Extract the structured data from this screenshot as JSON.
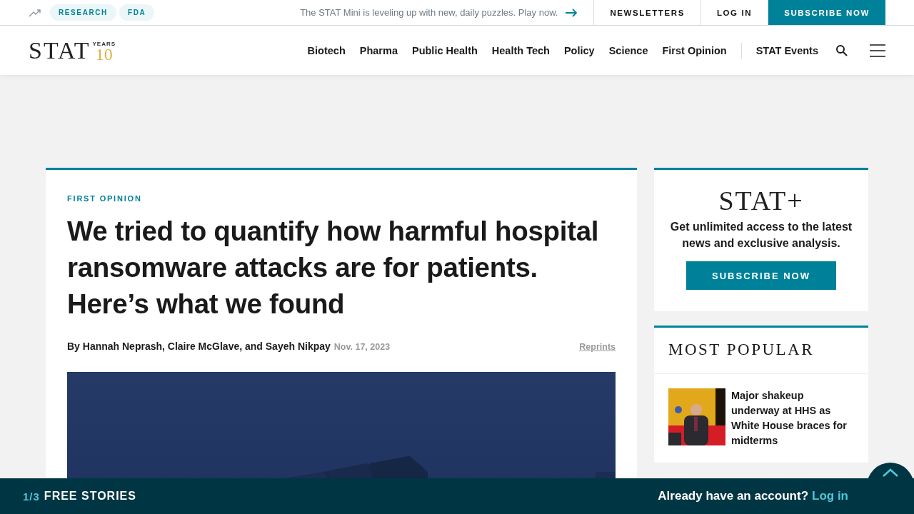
{
  "top_bar": {
    "topics": [
      "RESEARCH",
      "FDA"
    ],
    "promo": "The STAT Mini is leveling up with new, daily puzzles. Play now.",
    "links": [
      {
        "label": "NEWSLETTERS",
        "kind": "plain"
      },
      {
        "label": "LOG IN",
        "kind": "plain"
      },
      {
        "label": "SUBSCRIBE NOW",
        "kind": "primary"
      }
    ]
  },
  "header": {
    "logo": {
      "wordmark": "STAT",
      "number": "10",
      "label": "YEARS"
    },
    "nav": [
      "Biotech",
      "Pharma",
      "Public Health",
      "Health Tech",
      "Policy",
      "Science",
      "First Opinion"
    ],
    "events": "STAT Events"
  },
  "article": {
    "kicker": "FIRST OPINION",
    "headline": "We tried to quantify how harmful hospital ransomware attacks are for patients. Here’s what we found",
    "byline": "By Hannah Neprash, Claire McGlave, and Sayeh Nikpay",
    "date": "Nov. 17, 2023",
    "reprints": "Reprints"
  },
  "sidebar": {
    "promo": {
      "logo": "STAT+",
      "text": "Get unlimited access to the latest news and exclusive analysis.",
      "button": "SUBSCRIBE NOW"
    },
    "most_popular": {
      "title": "MOST POPULAR",
      "items": [
        {
          "headline": "Major shakeup underway at HHS as White House braces for midterms"
        }
      ]
    }
  },
  "footer_bar": {
    "count": "1/3",
    "label": "FREE STORIES",
    "prompt": "Already have an account?",
    "link": "Log in"
  }
}
